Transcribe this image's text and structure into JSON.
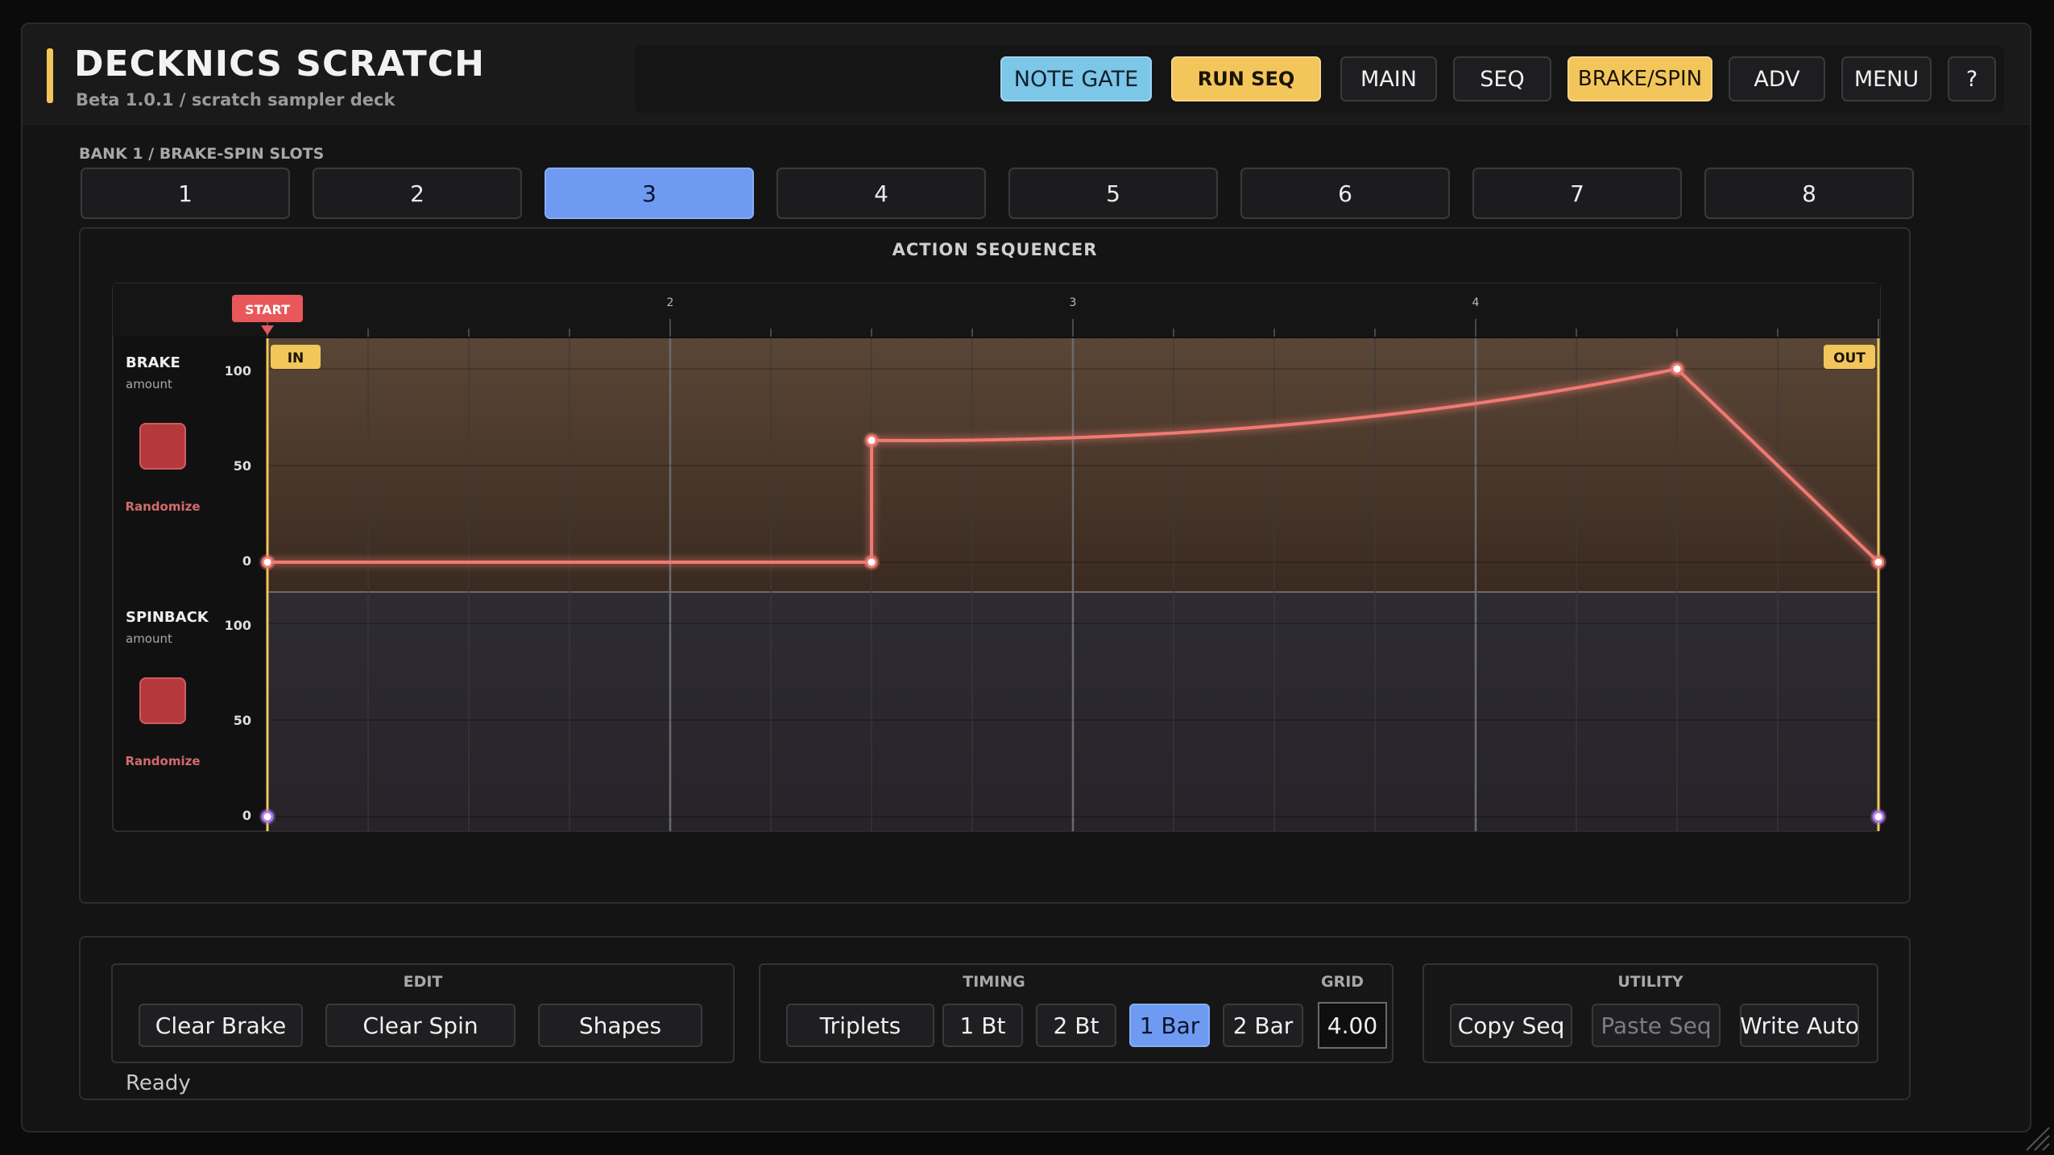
{
  "app": {
    "title": "DECKNICS SCRATCH",
    "subtitle": "Beta 1.0.1  /  scratch sampler deck",
    "accent_color": "#f2c65a"
  },
  "header_buttons": [
    {
      "label": "NOTE GATE",
      "style": "blue"
    },
    {
      "label": "RUN SEQ",
      "style": "yellow"
    },
    {
      "label": "MAIN",
      "style": "default"
    },
    {
      "label": "SEQ",
      "style": "default"
    },
    {
      "label": "BRAKE/SPIN",
      "style": "yellow"
    },
    {
      "label": "ADV",
      "style": "default"
    },
    {
      "label": "MENU",
      "style": "default"
    },
    {
      "label": "?",
      "style": "default"
    }
  ],
  "bank": {
    "label": "BANK 1 / BRAKE-SPIN SLOTS",
    "slots": [
      "1",
      "2",
      "3",
      "4",
      "5",
      "6",
      "7",
      "8"
    ],
    "active_slot": "3"
  },
  "sequencer": {
    "title": "ACTION SEQUENCER",
    "start_marker": "START",
    "bar_numbers": [
      "2",
      "3",
      "4"
    ],
    "in_label": "IN",
    "out_label": "OUT",
    "lanes": [
      {
        "name": "BRAKE",
        "sub": "amount",
        "randomize": "Randomize",
        "ticks": [
          "100",
          "50",
          "0"
        ],
        "color": "#f07a72",
        "points": [
          [
            1,
            0
          ],
          [
            2.5,
            0
          ],
          [
            2.5,
            63
          ],
          [
            4.5,
            100
          ],
          [
            5,
            0
          ]
        ]
      },
      {
        "name": "SPINBACK",
        "sub": "amount",
        "randomize": "Randomize",
        "ticks": [
          "100",
          "50",
          "0"
        ],
        "color": "#b07cf2",
        "points": [
          [
            1,
            0
          ],
          [
            5,
            0
          ]
        ]
      }
    ]
  },
  "edit": {
    "title": "EDIT",
    "buttons": [
      "Clear Brake",
      "Clear Spin",
      "Shapes"
    ]
  },
  "timing": {
    "title": "TIMING",
    "buttons": [
      "Triplets",
      "1 Bt",
      "2 Bt",
      "1 Bar",
      "2 Bar"
    ],
    "active": "1 Bar",
    "grid_label": "GRID",
    "grid_value": "4.00"
  },
  "utility": {
    "title": "UTILITY",
    "buttons": [
      "Copy Seq",
      "Paste Seq",
      "Write Auto"
    ],
    "disabled": [
      "Paste Seq"
    ]
  },
  "status": "Ready"
}
